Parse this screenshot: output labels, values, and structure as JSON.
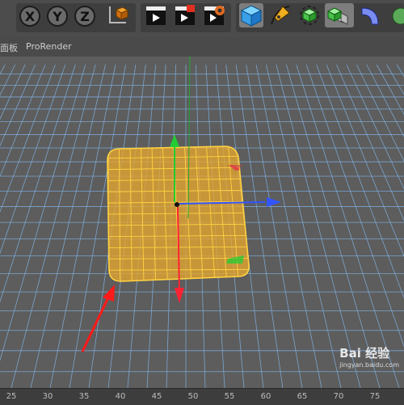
{
  "toolbar": {
    "axis_buttons": [
      {
        "label": "X"
      },
      {
        "label": "Y"
      },
      {
        "label": "Z"
      }
    ],
    "icons": [
      "axis-xyz-lock",
      "coordinate-system",
      "render-view",
      "render-to-picture-viewer",
      "render-settings",
      "cube-object",
      "pen-spline",
      "generator",
      "cloner-array",
      "deformer-bend"
    ]
  },
  "menubar": {
    "items": [
      "面板",
      "ProRender"
    ]
  },
  "ruler": {
    "labels": [
      "25",
      "30",
      "35",
      "40",
      "45",
      "50",
      "55",
      "60",
      "65",
      "70",
      "75"
    ]
  },
  "watermark": {
    "brand": "Bai 经验",
    "url": "jingyan.baidu.com"
  },
  "colors": {
    "grid_line": "#7fb2e3",
    "plane_fill": "#e6a630",
    "plane_wire": "#ffd240",
    "axis_y": "#22cc33",
    "axis_x": "#3355ff",
    "axis_z": "#ff2233",
    "annotation_arrow": "#ff1a1a"
  }
}
